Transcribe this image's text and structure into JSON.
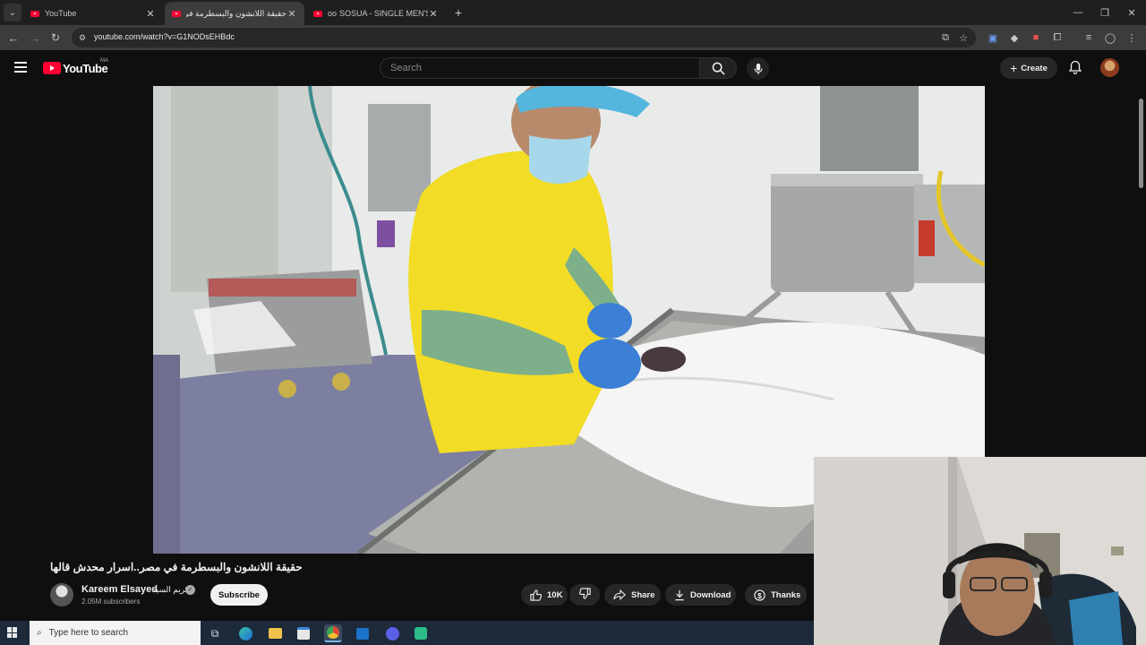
{
  "browser": {
    "tabs": [
      {
        "title": "YouTube",
        "active": false
      },
      {
        "title": "حقيقة اللانشون والبسطرمة في مـ",
        "active": true
      },
      {
        "title": "SOSUA - SINGLE MEN'S PAR",
        "active": false,
        "prefix": "oo"
      }
    ],
    "url": "youtube.com/watch?v=G1NODsEHBdc",
    "new_tab_icon": "plus-icon",
    "window_controls": [
      "minimize-icon",
      "restore-icon",
      "close-icon"
    ]
  },
  "youtube": {
    "logo_text": "YouTube",
    "country_code": "MA",
    "search_placeholder": "Search",
    "create_label": "Create",
    "video": {
      "title": "حقيقة اللانشون والبسطرمة في مصر..اسرار محدش قالها",
      "channel_name": "Kareem Elsayed",
      "channel_name_ar": "كريم السيد",
      "subscribers": "2.05M subscribers",
      "subscribe_label": "Subscribe",
      "likes": "10K",
      "share_label": "Share",
      "download_label": "Download",
      "thanks_label": "Thanks"
    }
  },
  "taskbar": {
    "search_placeholder": "Type here to search",
    "apps": [
      "task-view-icon",
      "edge-icon",
      "file-explorer-icon",
      "store-icon",
      "chrome-icon",
      "outlook-icon",
      "discord-icon",
      "android-app-icon"
    ]
  },
  "colors": {
    "youtube_red": "#ff0033",
    "background": "#0f0f0f",
    "pill": "#272727"
  }
}
